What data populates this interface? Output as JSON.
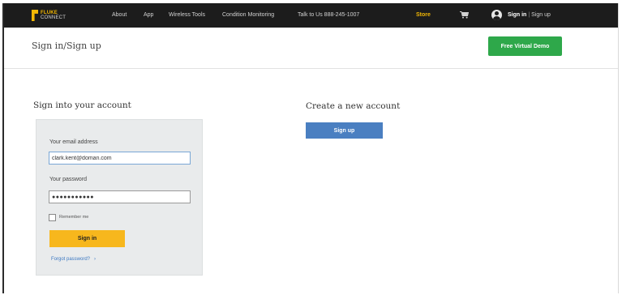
{
  "nav": {
    "logo_line1": "FLUKE",
    "logo_line2": "CONNECT",
    "links": [
      "About",
      "App",
      "Wireless Tools",
      "Condition Monitoring",
      "Talk to Us 888-245-1007"
    ],
    "store": "Store",
    "sign_in": "Sign in",
    "separator": "|",
    "sign_up": "Sign up"
  },
  "header": {
    "title": "Sign in/Sign up",
    "demo_button": "Free Virtual Demo"
  },
  "signin": {
    "title": "Sign into your account",
    "email_label": "Your email address",
    "email_value": "clark.kent@doman.com",
    "password_label": "Your password",
    "password_value": "●●●●●●●●●●●",
    "remember_label": "Remember me",
    "button": "Sign in",
    "forgot": "Forgot password?",
    "forgot_arrow": "›"
  },
  "signup": {
    "title": "Create a new account",
    "button": "Sign up"
  },
  "colors": {
    "nav_bg": "#1c1c1c",
    "brand_yellow": "#f2b705",
    "demo_green": "#2ea84a",
    "signup_blue": "#4a7fc1",
    "signin_yellow": "#f7b71d"
  }
}
